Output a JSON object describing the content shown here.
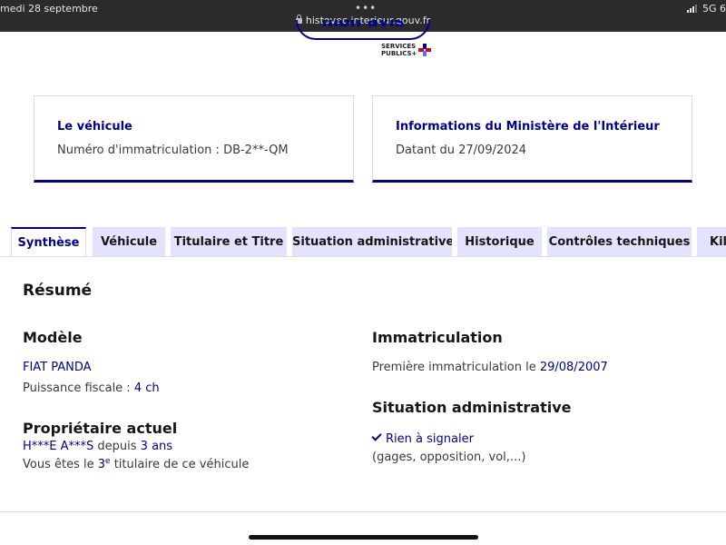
{
  "status_bar": {
    "date": "medi 28 septembre",
    "network": "5G 6",
    "url": "histovec.interieur.gouv.fr"
  },
  "header": {
    "logo_text": "mon avis",
    "sp_line1": "SERVICES",
    "sp_line2": "PUBLICS+"
  },
  "cards": {
    "vehicle": {
      "title": "Le véhicule",
      "text": "Numéro d'immatriculation : DB-2**-QM"
    },
    "ministry": {
      "title": "Informations du Ministère de l'Intérieur",
      "text": "Datant du 27/09/2024"
    }
  },
  "tabs": [
    {
      "label": "Synthèse"
    },
    {
      "label": "Véhicule"
    },
    {
      "label": "Titulaire et Titre"
    },
    {
      "label": "Situation administrative"
    },
    {
      "label": "Historique"
    },
    {
      "label": "Contrôles techniques"
    },
    {
      "label": "Kilo"
    }
  ],
  "summary": {
    "title": "Résumé",
    "model": {
      "heading": "Modèle",
      "name": "FIAT PANDA",
      "power_label": "Puissance fiscale : ",
      "power_value": "4 ch"
    },
    "owner": {
      "heading": "Propriétaire actuel",
      "name": "H***E A***S",
      "since_label": " depuis ",
      "since_value": "3 ans",
      "rank_prefix": "Vous êtes le ",
      "rank_number": "3",
      "rank_sup": "e",
      "rank_suffix": " titulaire de ce véhicule"
    },
    "registration": {
      "heading": "Immatriculation",
      "label": "Première immatriculation le ",
      "date": "29/08/2007"
    },
    "admin": {
      "heading": "Situation administrative",
      "status": "Rien à signaler",
      "detail": "(gages, opposition, vol,...)"
    }
  }
}
